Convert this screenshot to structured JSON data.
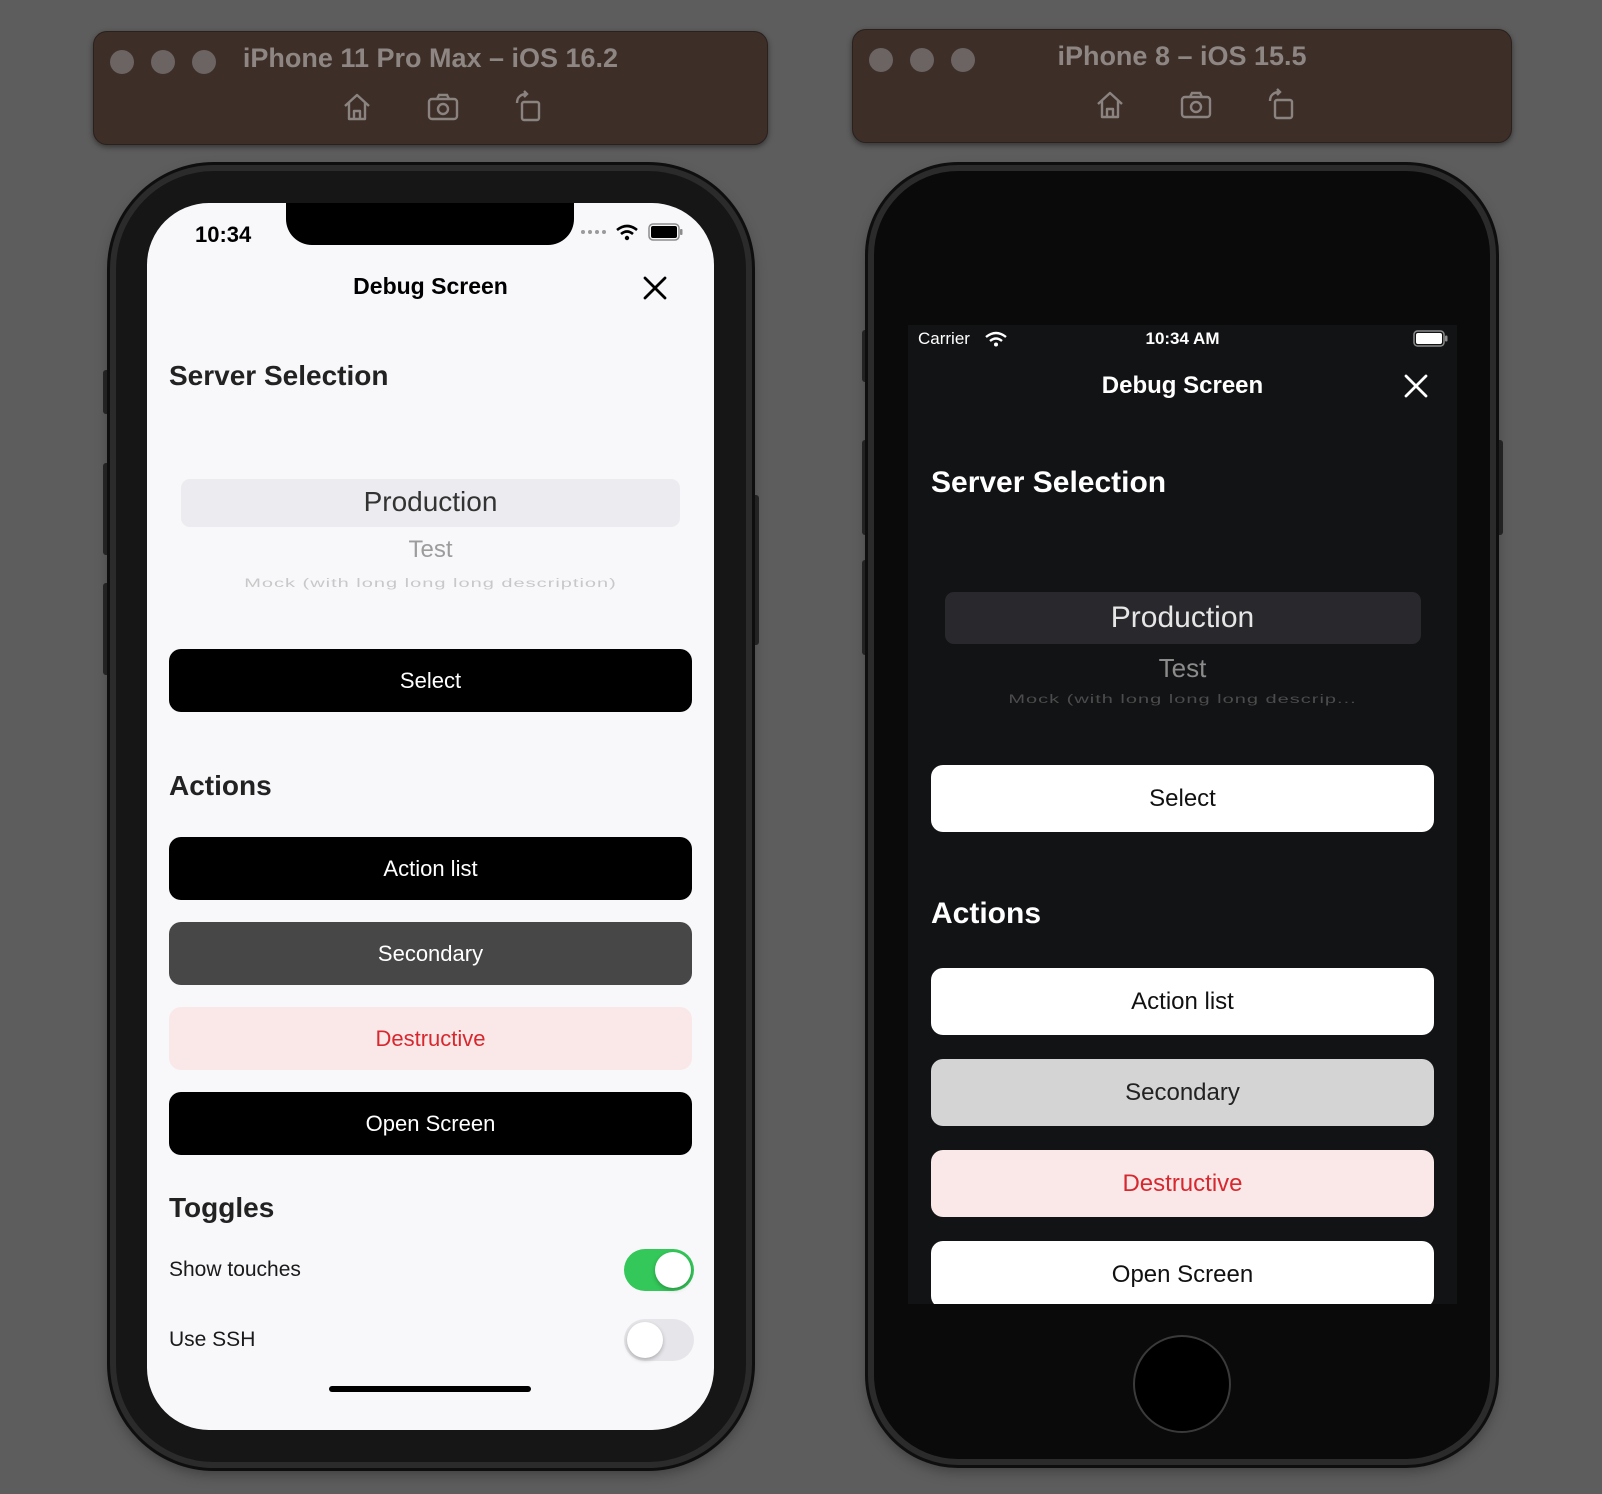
{
  "simulators": [
    {
      "title": "iPhone 11 Pro Max – iOS 16.2",
      "toolbar_icons": [
        "home-icon",
        "screenshot-icon",
        "rotate-icon"
      ]
    },
    {
      "title": "iPhone 8 – iOS 15.5",
      "toolbar_icons": [
        "home-icon",
        "screenshot-icon",
        "rotate-icon"
      ]
    }
  ],
  "left_screen": {
    "theme": "light",
    "status_bar": {
      "time": "10:34"
    },
    "nav": {
      "title": "Debug Screen",
      "close_icon": "close-icon"
    },
    "server_selection": {
      "heading": "Server Selection",
      "picker": [
        "Production",
        "Test",
        "Mock (with long long long description)"
      ],
      "selected": "Production",
      "select_button": "Select"
    },
    "actions": {
      "heading": "Actions",
      "buttons": [
        "Action list",
        "Secondary",
        "Destructive",
        "Open Screen"
      ]
    },
    "toggles": {
      "heading": "Toggles",
      "items": [
        {
          "label": "Show touches",
          "on": true
        },
        {
          "label": "Use SSH",
          "on": false
        }
      ]
    }
  },
  "right_screen": {
    "theme": "dark",
    "status_bar": {
      "carrier": "Carrier",
      "time": "10:34 AM"
    },
    "nav": {
      "title": "Debug Screen",
      "close_icon": "close-icon"
    },
    "server_selection": {
      "heading": "Server Selection",
      "picker": [
        "Production",
        "Test",
        "Mock (with long long long descrip..."
      ],
      "selected": "Production",
      "select_button": "Select"
    },
    "actions": {
      "heading": "Actions",
      "buttons": [
        "Action list",
        "Secondary",
        "Destructive",
        "Open Screen"
      ]
    }
  },
  "colors": {
    "toggle_on": "#34c759",
    "destructive_text": "#d7282f",
    "destructive_bg": "#fae8e8",
    "secondary_light": "#474747",
    "secondary_dark": "#d4d4d4"
  }
}
